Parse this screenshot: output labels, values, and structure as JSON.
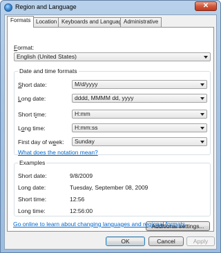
{
  "window": {
    "title": "Region and Language",
    "close_glyph": "✕"
  },
  "tabs": [
    {
      "label": "Formats",
      "active": true
    },
    {
      "label": "Location",
      "active": false
    },
    {
      "label": "Keyboards and Languages",
      "active": false
    },
    {
      "label": "Administrative",
      "active": false
    }
  ],
  "format": {
    "label": "Format:",
    "value": "English (United States)"
  },
  "date_time": {
    "title": "Date and time formats",
    "short_date": {
      "label": "Short date:",
      "value": "M/d/yyyy"
    },
    "long_date": {
      "label": "Long date:",
      "value": "dddd, MMMM dd, yyyy"
    },
    "short_time": {
      "label": "Short time:",
      "value": "H:mm"
    },
    "long_time": {
      "label": "Long time:",
      "value": "H:mm:ss"
    },
    "first_day": {
      "label": "First day of week:",
      "value": "Sunday"
    },
    "notation_link": "What does the notation mean?"
  },
  "examples": {
    "title": "Examples",
    "rows": [
      {
        "label": "Short date:",
        "value": "9/8/2009"
      },
      {
        "label": "Long date:",
        "value": "Tuesday, September 08, 2009"
      },
      {
        "label": "Short time:",
        "value": "12:56"
      },
      {
        "label": "Long time:",
        "value": "12:56:00"
      }
    ]
  },
  "additional_settings": "Additional settings...",
  "online_link": "Go online to learn about changing languages and regional formats",
  "buttons": {
    "ok": "OK",
    "cancel": "Cancel",
    "apply": "Apply"
  }
}
